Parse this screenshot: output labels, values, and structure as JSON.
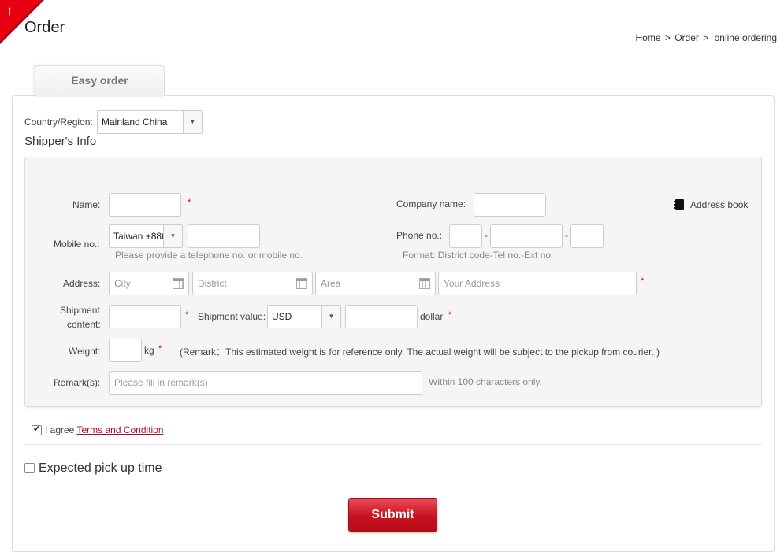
{
  "header": {
    "title": "Order",
    "breadcrumb": [
      "Home",
      "Order",
      "online ordering"
    ],
    "separator": ">"
  },
  "tab": {
    "label": "Easy order"
  },
  "country": {
    "label": "Country/Region:",
    "value": "Mainland China"
  },
  "section_title": "Shipper's Info",
  "fields": {
    "name_label": "Name:",
    "company_label": "Company name:",
    "address_book": "Address book",
    "mobile_label": "Mobile no.:",
    "mobile_code": "Taiwan +886",
    "phone_label": "Phone no.:",
    "phone_hint": "Please provide a telephone no. or mobile no.",
    "phone_format": "Format: District code-Tel no.-Ext no.",
    "address_label": "Address:",
    "city_placeholder": "City",
    "district_placeholder": "District",
    "area_placeholder": "Area",
    "address_placeholder": "Your Address",
    "shipment_content_label_1": "Shipment",
    "shipment_content_label_2": "content:",
    "shipment_value_label": "Shipment value:",
    "currency": "USD",
    "dollar": "dollar",
    "weight_label": "Weight:",
    "weight_unit": "kg",
    "weight_remark": "(Remark：This estimated weight is for reference only. The actual weight will be subject to the pickup from courier. )",
    "remarks_label": "Remark(s):",
    "remarks_placeholder": "Please fill in remark(s)",
    "remarks_hint": "Within 100 characters only.",
    "required_mark": "*",
    "dash": "-"
  },
  "agree": {
    "prefix": "I agree",
    "link": "Terms and Condition",
    "checked": true
  },
  "pickup": {
    "label": "Expected pick up time",
    "checked": false
  },
  "submit": {
    "label": "Submit"
  },
  "colors": {
    "brand_red": "#e60012",
    "submit_red": "#c8101f",
    "link_red": "#b0102a"
  }
}
